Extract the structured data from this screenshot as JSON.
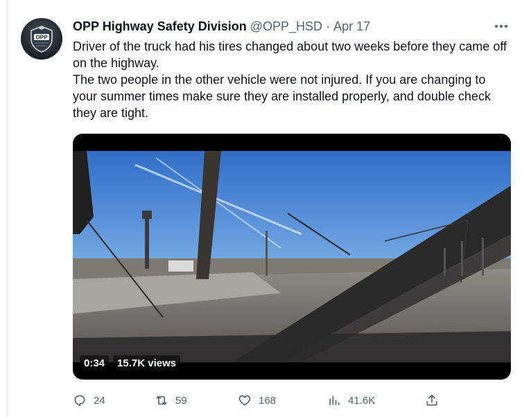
{
  "author": {
    "name": "OPP Highway Safety Division",
    "handle": "@OPP_HSD",
    "separator": "·",
    "date": "Apr 17",
    "avatar_text": "OPP"
  },
  "tweet": {
    "paragraphs": [
      "Driver of the truck had his tires changed about two weeks before they came off on the highway.",
      "The two people in the other vehicle were not injured. If you are changing to your summer times make sure they are installed properly, and double check they are tight."
    ]
  },
  "video": {
    "duration": "0:34",
    "views": "15.7K views"
  },
  "actions": {
    "replies": "24",
    "retweets": "59",
    "likes": "168",
    "views": "41.6K"
  },
  "icons": {
    "more": "more-icon",
    "reply": "reply-icon",
    "retweet": "retweet-icon",
    "like": "heart-icon",
    "views": "views-icon",
    "share": "share-icon"
  },
  "colors": {
    "secondary_text": "#536471",
    "primary_text": "#0f1419"
  }
}
